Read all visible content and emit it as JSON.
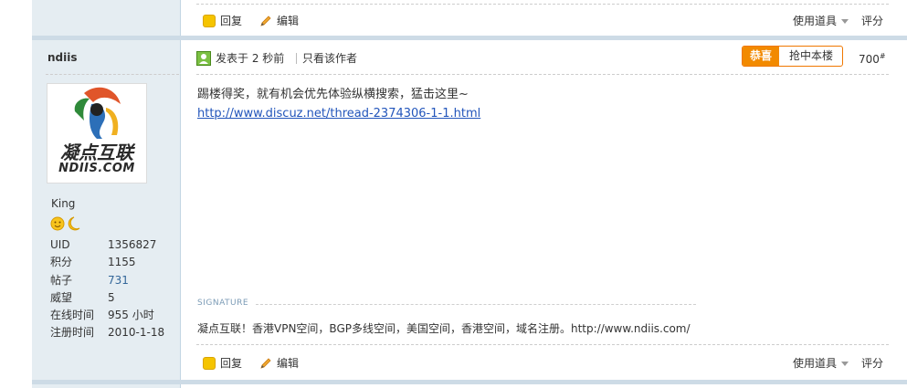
{
  "actions": {
    "reply": "回复",
    "edit": "编辑",
    "tools": "使用道具",
    "rate": "评分"
  },
  "user": {
    "name": "ndiis",
    "avatar_text_main": "凝点互联",
    "avatar_text_sub": "NDIIS.COM",
    "rank": "King",
    "stats": [
      {
        "key": "UID",
        "value": "1356827"
      },
      {
        "key": "积分",
        "value": "1155"
      },
      {
        "key": "帖子",
        "value": "731"
      },
      {
        "key": "威望",
        "value": "5"
      },
      {
        "key": "在线时间",
        "value": "955 小时"
      },
      {
        "key": "注册时间",
        "value": "2010-1-18"
      }
    ]
  },
  "post": {
    "posted": "发表于 2 秒前",
    "only_author": "只看该作者",
    "congrats_badge": "恭喜",
    "congrats_text": "抢中本楼",
    "floor": "700",
    "floor_sup": "#",
    "message": "踢楼得奖，就有机会优先体验纵横搜索，猛击这里~",
    "link": "http://www.discuz.net/thread-2374306-1-1.html",
    "signature_label": "SIGNATURE",
    "signature": "凝点互联！香港VPN空间，BGP多线空间，美国空间，香港空间，域名注册。http://www.ndiis.com/"
  },
  "colors": {
    "sidebar_bg": "#e5edf2",
    "separator": "#cddbe6",
    "link": "#2255bb",
    "congrats_orange": "#f28a00"
  }
}
